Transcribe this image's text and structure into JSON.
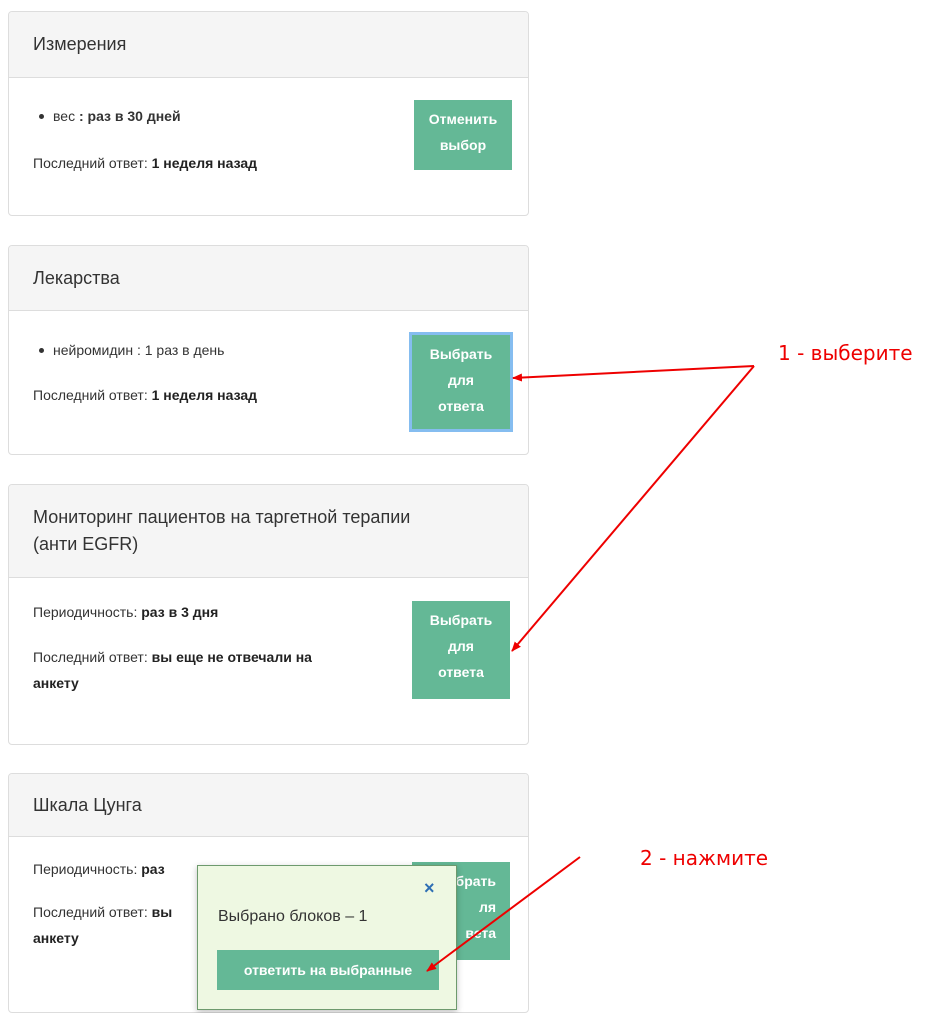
{
  "panels": [
    {
      "title": "Измерения",
      "bullet_name": "вес",
      "bullet_value": ": раз в 30 дней",
      "last_answer_label": "Последний ответ:",
      "last_answer_value": "1 неделя назад",
      "button_line1": "Отменить",
      "button_line2": "выбор"
    },
    {
      "title": "Лекарства",
      "bullet_text": "нейромидин : 1 раз в день",
      "last_answer_label": "Последний ответ:",
      "last_answer_value": "1 неделя назад",
      "button_line1": "Выбрать",
      "button_line2": "для",
      "button_line3": "ответа"
    },
    {
      "title_line1": "Мониторинг пациентов на таргетной терапии",
      "title_line2": "(анти EGFR)",
      "periodicity_label": "Периодичность:",
      "periodicity_value": "раз в 3 дня",
      "last_answer_label": "Последний ответ:",
      "last_answer_value_line1": "вы еще не отвечали на",
      "last_answer_value_line2": "анкету",
      "button_line1": "Выбрать",
      "button_line2": "для",
      "button_line3": "ответа"
    },
    {
      "title": "Шкала Цунга",
      "periodicity_label": "Периодичность:",
      "periodicity_value_visible": "раз",
      "last_answer_label": "Последний ответ:",
      "last_answer_value_visible": "вы",
      "last_answer_value_line2": "анкету",
      "button_visible_line1": "брать",
      "button_visible_line2": "ля",
      "button_visible_line3": "вета"
    }
  ],
  "popup": {
    "close_symbol": "×",
    "selected_count_text": "Выбрано блоков – 1",
    "answer_button_label": "ответить на выбранные"
  },
  "annotations": {
    "step1": "1 - выберите",
    "step2": "2 - нажмите",
    "color": "#ee0000"
  },
  "colors": {
    "button_green": "#64b896",
    "panel_heading_bg": "#f5f5f5",
    "popup_bg": "#eef8e2",
    "focus_outline": "#85bdf0"
  }
}
